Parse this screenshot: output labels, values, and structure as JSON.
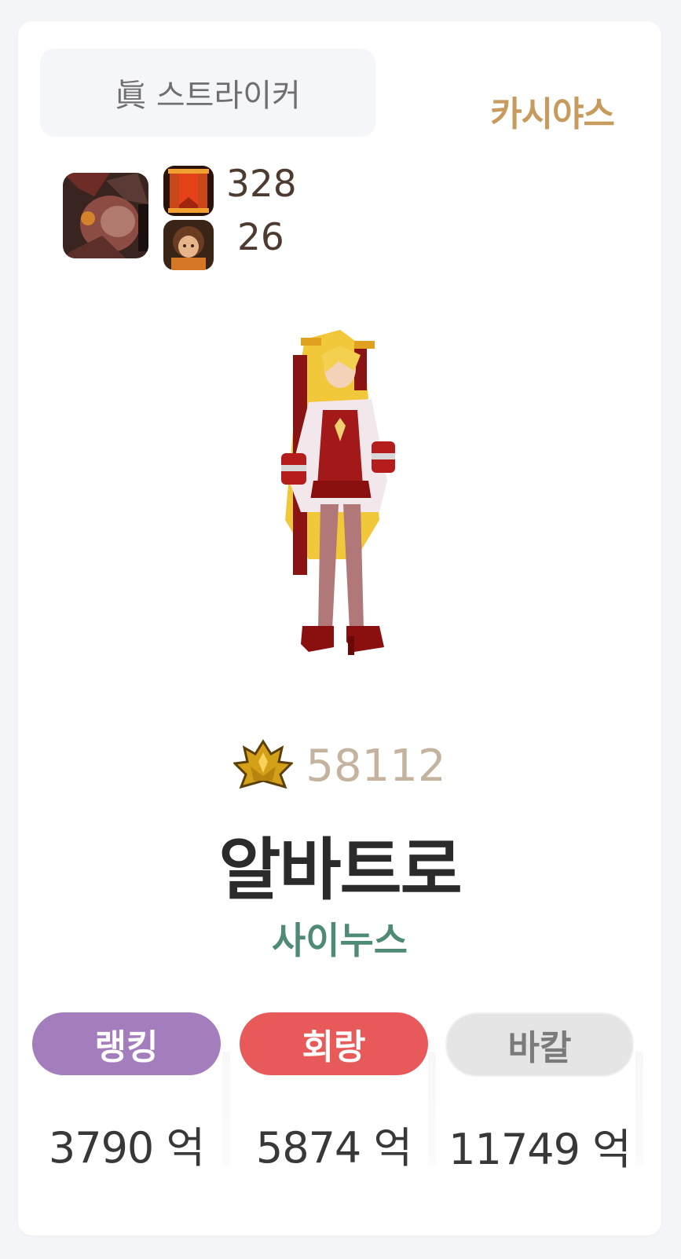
{
  "profile": {
    "class_name": "眞 스트라이커",
    "server": "카시야스",
    "badge_count_1": "328",
    "badge_count_2": "26",
    "fame": "58112",
    "character_name": "알바트로",
    "guild": "사이누스"
  },
  "stats": [
    {
      "label": "랭킹",
      "value": "3790 억",
      "color": "#a47dbd"
    },
    {
      "label": "회랑",
      "value": "5874 억",
      "color": "#e85a59"
    },
    {
      "label": "바칼",
      "value": "11749 억",
      "color": "#e5e5e5"
    }
  ],
  "icons": {
    "avatar": "creature-portrait-icon",
    "badge_1": "red-banner-icon",
    "badge_2": "character-face-icon",
    "fame": "gold-crest-icon"
  },
  "colors": {
    "server": "#c79a5e",
    "guild": "#4f8a78",
    "fame": "#c4b39e"
  }
}
